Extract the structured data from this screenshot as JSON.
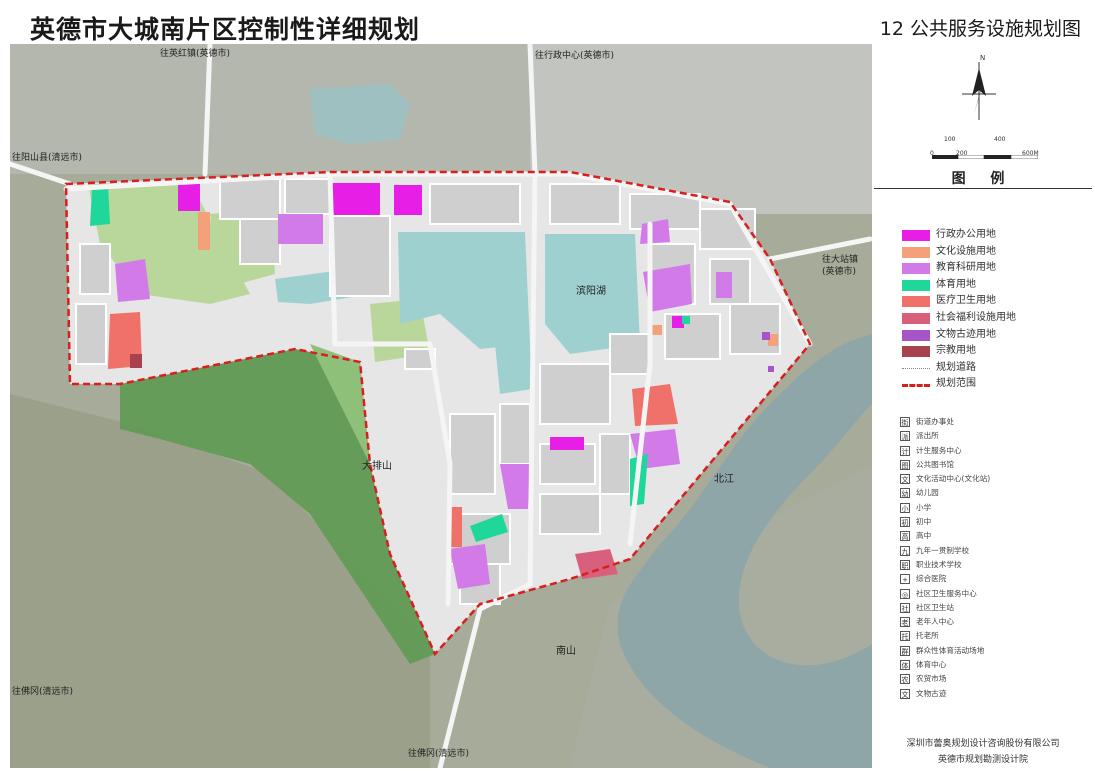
{
  "title": "英德市大城南片区控制性详细规划",
  "subtitle": "12  公共服务设施规划图",
  "compass_letter": "N",
  "scale_labels": [
    "0",
    "100",
    "200",
    "400",
    "600M"
  ],
  "legend_heading": "图 例",
  "legend_items": [
    {
      "label": "行政办公用地",
      "color": "#e61ee6",
      "kind": "fill"
    },
    {
      "label": "文化设施用地",
      "color": "#f4a07a",
      "kind": "fill"
    },
    {
      "label": "教育科研用地",
      "color": "#d27be8",
      "kind": "fill"
    },
    {
      "label": "体育用地",
      "color": "#1fd79a",
      "kind": "fill"
    },
    {
      "label": "医疗卫生用地",
      "color": "#f0706a",
      "kind": "fill"
    },
    {
      "label": "社会福利设施用地",
      "color": "#d9607c",
      "kind": "fill"
    },
    {
      "label": "文物古迹用地",
      "color": "#a555c8",
      "kind": "fill"
    },
    {
      "label": "宗教用地",
      "color": "#a8424f",
      "kind": "fill"
    },
    {
      "label": "规划道路",
      "color": "#888888",
      "kind": "road"
    },
    {
      "label": "规划范围",
      "color": "#d91e1e",
      "kind": "dash"
    }
  ],
  "symbol_items": [
    {
      "icon": "街",
      "label": "街道办事处"
    },
    {
      "icon": "派",
      "label": "派出所"
    },
    {
      "icon": "计",
      "label": "计生服务中心"
    },
    {
      "icon": "图",
      "label": "公共图书馆"
    },
    {
      "icon": "文",
      "label": "文化活动中心(文化站)"
    },
    {
      "icon": "幼",
      "label": "幼儿园"
    },
    {
      "icon": "小",
      "label": "小学"
    },
    {
      "icon": "初",
      "label": "初中"
    },
    {
      "icon": "高",
      "label": "高中"
    },
    {
      "icon": "九",
      "label": "九年一贯制学校"
    },
    {
      "icon": "职",
      "label": "职业技术学校"
    },
    {
      "icon": "+",
      "label": "综合医院"
    },
    {
      "icon": "◎",
      "label": "社区卫生服务中心"
    },
    {
      "icon": "社",
      "label": "社区卫生站"
    },
    {
      "icon": "老",
      "label": "老年人中心"
    },
    {
      "icon": "托",
      "label": "托老所"
    },
    {
      "icon": "群",
      "label": "群众性体育活动场地"
    },
    {
      "icon": "体",
      "label": "体育中心"
    },
    {
      "icon": "农",
      "label": "农贸市场"
    },
    {
      "icon": "文",
      "label": "文物古迹"
    }
  ],
  "map_labels": {
    "to_yinghong": "往英红镇(英德市)",
    "to_admin": "往行政中心(英德市)",
    "to_yangshan": "往阳山县(清远市)",
    "to_dazhan": "往大站镇",
    "to_dazhan2": "(英德市)",
    "to_fogang": "往佛冈(清远市)",
    "to_fogang_south": "往佛冈(清远市)",
    "dapai_mountain": "大排山",
    "nan_mountain": "南山",
    "bei_river": "北江",
    "binyang_lake": "滨阳湖"
  },
  "credits": [
    "深圳市蕾奥规划设计咨询股份有限公司",
    "英德市规划勘测设计院"
  ]
}
